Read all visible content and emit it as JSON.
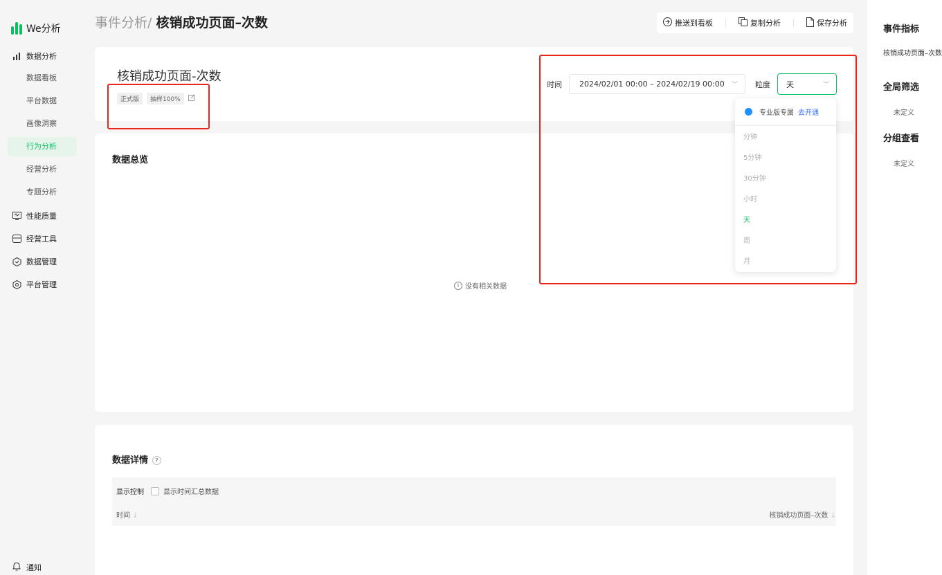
{
  "app": {
    "logo_text": "We分析",
    "brand_color": "#07c160"
  },
  "sidebar": {
    "sections": [
      {
        "label": "数据分析",
        "icon": "bar-chart-icon"
      },
      {
        "label": "性能质量",
        "icon": "monitor-icon"
      },
      {
        "label": "经营工具",
        "icon": "store-icon"
      },
      {
        "label": "数据管理",
        "icon": "data-hex-icon"
      },
      {
        "label": "平台管理",
        "icon": "settings-icon"
      }
    ],
    "sub_items": [
      "数据看板",
      "平台数据",
      "画像洞察",
      "行为分析",
      "经营分析",
      "专题分析"
    ],
    "active_item": "行为分析",
    "notice": "通知"
  },
  "header": {
    "crumb": "事件分析/",
    "current": "核销成功页面–次数",
    "actions": [
      "推送到看板",
      "复制分析",
      "保存分析"
    ]
  },
  "event": {
    "title": "核销成功页面-次数",
    "tags": [
      "正式版",
      "抽样100%"
    ]
  },
  "filters": {
    "time_label": "时间",
    "date_range": "2024/02/01 00:00 – 2024/02/19 00:00",
    "granularity_label": "粒度",
    "granularity_value": "天"
  },
  "dropdown": {
    "pro_text": "专业版专属",
    "pro_link": "去开通",
    "options": [
      "分钟",
      "5分钟",
      "30分钟",
      "小时",
      "天",
      "周",
      "月"
    ],
    "selected": "天"
  },
  "overview": {
    "title": "数据总览",
    "empty_text": "没有相关数据"
  },
  "detail": {
    "title": "数据详情",
    "show_control": "显示控制",
    "checkbox_label": "显示时间汇总数据",
    "checkbox_checked": false,
    "columns": [
      "时间",
      "核销成功页面–次数"
    ]
  },
  "right_panel": {
    "event_metrics_title": "事件指标",
    "event_metric_item": "核销成功页面–次数",
    "global_filter_title": "全局筛选",
    "global_filter_value": "未定义",
    "group_title": "分组查看",
    "group_value": "未定义"
  }
}
